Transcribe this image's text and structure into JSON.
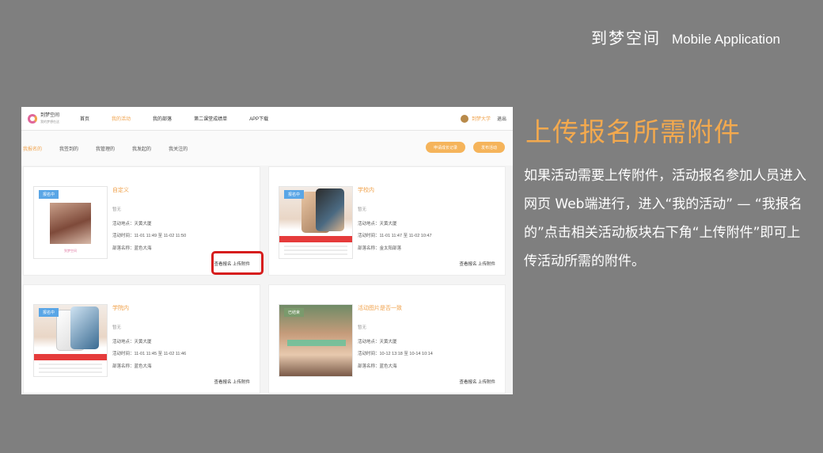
{
  "header": {
    "cn_title": "到梦空间",
    "en_title": "Mobile Application"
  },
  "app": {
    "logo_title": "到梦空间",
    "logo_subtitle": "我的梦想在这",
    "nav": [
      "首页",
      "我的活动",
      "我的部落",
      "第二课堂成绩单",
      "APP下载"
    ],
    "nav_active_index": 1,
    "user_name": "到梦大学",
    "logout": "退出",
    "sub_tabs": [
      "我报名的",
      "我签到的",
      "我管理的",
      "我发起的",
      "我关注的"
    ],
    "sub_tabs_active_index": 0,
    "btn_history": "申请成长记录",
    "btn_publish": "发布活动",
    "cards": [
      {
        "badge": "报名中",
        "title": "自定义",
        "desc": "暂无",
        "place": "活动地点：天黄大厦",
        "time": "活动时间：11-01 11:49 至 11-02 11:50",
        "tribe": "部落名称：蓝色大海",
        "actions": "查看报名 上传附件",
        "thumb_footer": "到梦空间",
        "highlighted": true
      },
      {
        "badge": "报名中",
        "title": "学校内",
        "desc": "暂无",
        "place": "活动地点：天黄大厦",
        "time": "活动时间：11-01 11:47 至 11-02 10:47",
        "tribe": "部落名称：金太阳部落",
        "actions": "查看报名 上传附件",
        "highlighted": false
      },
      {
        "badge": "报名中",
        "title": "学院内",
        "desc": "暂无",
        "place": "活动地点：天黄大厦",
        "time": "活动时间：11-01 11:45 至 11-02 11:46",
        "tribe": "部落名称：蓝色大海",
        "actions": "查看报名 上传附件",
        "highlighted": false
      },
      {
        "badge": "已结束",
        "title": "活动图片是否一致",
        "desc": "暂无",
        "place": "活动地点：天黄大厦",
        "time": "活动时间：10-12 13:18 至 10-14 10:14",
        "tribe": "部落名称：蓝色大海",
        "actions": "查看报名 上传附件",
        "highlighted": false
      }
    ]
  },
  "heading": "上传报名所需附件",
  "body": "如果活动需要上传附件，活动报名参加人员进入网页 Web端进行，进入“我的活动” — “我报名的”点击相关活动板块右下角“上传附件”即可上传活动所需的附件。",
  "colors": {
    "accent": "#f3a94e",
    "background": "#7f7f7f",
    "highlight": "#d61d1d",
    "badge": "#5aa6e6"
  }
}
